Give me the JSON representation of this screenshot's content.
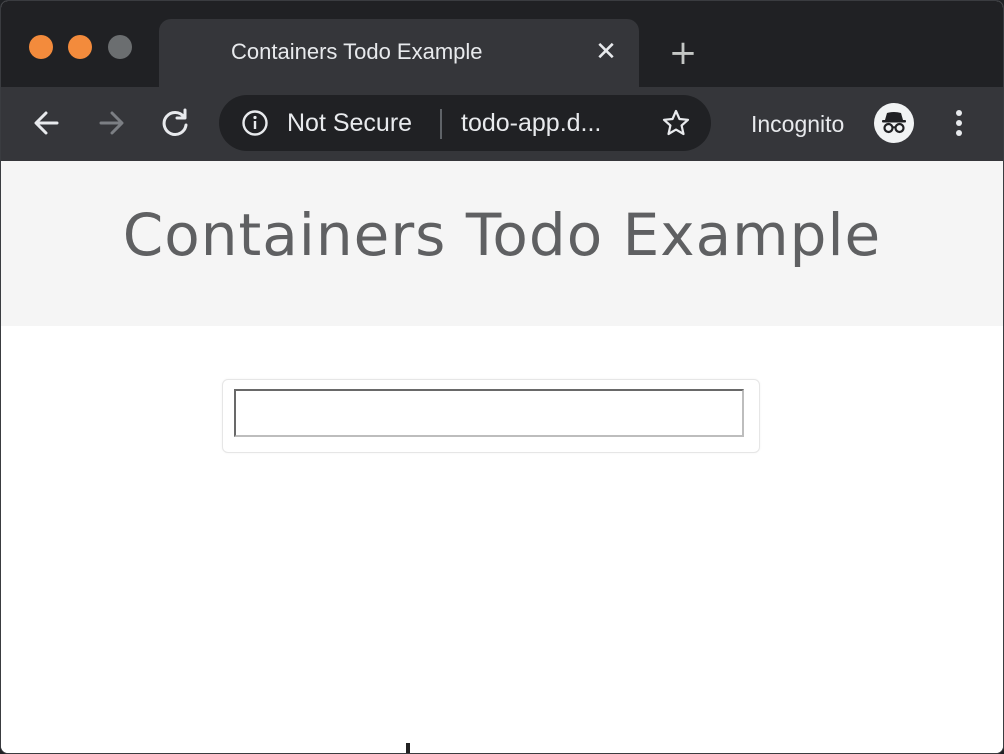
{
  "browser": {
    "tab": {
      "title": "Containers Todo Example",
      "close_icon": "close-icon"
    },
    "new_tab_icon": "plus-icon",
    "toolbar": {
      "back_icon": "arrow-left-icon",
      "forward_icon": "arrow-right-icon",
      "reload_icon": "reload-icon",
      "security_icon": "info-icon",
      "security_label": "Not Secure",
      "url": "todo-app.d...",
      "bookmark_icon": "star-icon",
      "profile_label": "Incognito",
      "profile_icon": "incognito-icon",
      "menu_icon": "vertical-dots-icon"
    },
    "colors": {
      "traffic_close": "#f38b3c",
      "traffic_minimize": "#f38b3c",
      "traffic_maximize": "#6b6e70",
      "tabstrip_bg": "#202124",
      "toolbar_bg": "#35363a"
    }
  },
  "page": {
    "title": "Containers Todo Example",
    "todo_input": {
      "value": "",
      "placeholder": ""
    },
    "colors": {
      "header_bg": "#f5f5f5",
      "title_color": "#5f6062"
    }
  }
}
